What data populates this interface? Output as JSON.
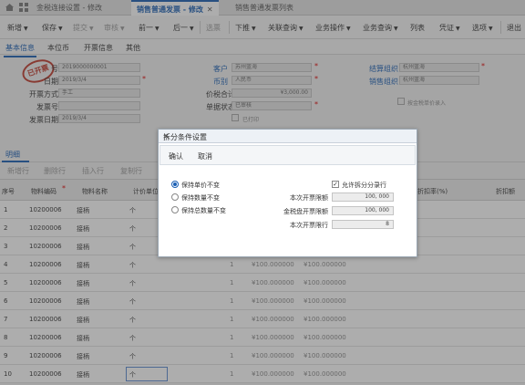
{
  "tabs": [
    {
      "label": "金税连接设置 - 修改",
      "active": false
    },
    {
      "label": "销售普通发票 - 修改",
      "active": true
    },
    {
      "label": "销售普通发票列表",
      "active": false
    }
  ],
  "toolbar": {
    "items": [
      {
        "label": "新增",
        "caret": true,
        "disabled": false
      },
      {
        "label": "保存",
        "caret": true,
        "disabled": false
      },
      {
        "label": "提交",
        "caret": true,
        "disabled": true
      },
      {
        "label": "审核",
        "caret": true,
        "disabled": true
      },
      {
        "label": "前一",
        "caret": true,
        "disabled": false
      },
      {
        "label": "后一",
        "caret": true,
        "disabled": false
      },
      {
        "label": "选票",
        "caret": false,
        "disabled": true
      },
      {
        "label": "下推",
        "caret": true,
        "disabled": false
      },
      {
        "label": "关联查询",
        "caret": true,
        "disabled": false
      },
      {
        "label": "业务操作",
        "caret": true,
        "disabled": false
      },
      {
        "label": "业务查询",
        "caret": true,
        "disabled": false
      },
      {
        "label": "列表",
        "caret": false,
        "disabled": false
      },
      {
        "label": "凭证",
        "caret": true,
        "disabled": false
      },
      {
        "label": "选项",
        "caret": true,
        "disabled": false
      },
      {
        "label": "退出",
        "caret": false,
        "disabled": false
      }
    ]
  },
  "subtabs": [
    "基本信息",
    "本位币",
    "开票信息",
    "其他"
  ],
  "form": {
    "stamp": "已开票",
    "row1": {
      "label": "号",
      "value": "2019000000001"
    },
    "row2": {
      "label": "日期",
      "value": "2019/3/4"
    },
    "row3": {
      "label": "开票方式",
      "value": "手工"
    },
    "row4": {
      "label": "发票号",
      "value": ""
    },
    "row5": {
      "label": "发票日期",
      "value": "2019/3/4"
    },
    "customer": {
      "label": "客户",
      "value": "苏州蓝海"
    },
    "currency": {
      "label": "币别",
      "value": "人民币"
    },
    "tax_total": {
      "label": "价税合计",
      "value": "¥3,000.00"
    },
    "doc_status": {
      "label": "单据状态",
      "value": "已审核"
    },
    "print_check": "已打印",
    "settle_org": {
      "label": "结算组织",
      "value": "杭州蓝海"
    },
    "sales_org": {
      "label": "销售组织",
      "value": "杭州蓝海"
    },
    "tax_check": "按金税单价录入"
  },
  "grid": {
    "section_title": "明细",
    "tools": [
      "新增行",
      "删除行",
      "插入行",
      "复制行"
    ],
    "headers": [
      "序号",
      "物料编码",
      "物料名称",
      "计价单位",
      "折扣率(%)",
      "折扣额"
    ],
    "rows": [
      {
        "seq": "1",
        "code": "10200006",
        "name": "接柄",
        "unit": "个",
        "qty": "",
        "price": "",
        "amount": ""
      },
      {
        "seq": "2",
        "code": "10200006",
        "name": "接柄",
        "unit": "个",
        "qty": "",
        "price": "",
        "amount": ""
      },
      {
        "seq": "3",
        "code": "10200006",
        "name": "接柄",
        "unit": "个",
        "qty": "",
        "price": "",
        "amount": ""
      },
      {
        "seq": "4",
        "code": "10200006",
        "name": "接柄",
        "unit": "个",
        "qty": "1",
        "price": "¥100.000000",
        "amount": "¥100.000000"
      },
      {
        "seq": "5",
        "code": "10200006",
        "name": "接柄",
        "unit": "个",
        "qty": "1",
        "price": "¥100.000000",
        "amount": "¥100.000000"
      },
      {
        "seq": "6",
        "code": "10200006",
        "name": "接柄",
        "unit": "个",
        "qty": "1",
        "price": "¥100.000000",
        "amount": "¥100.000000"
      },
      {
        "seq": "7",
        "code": "10200006",
        "name": "接柄",
        "unit": "个",
        "qty": "1",
        "price": "¥100.000000",
        "amount": "¥100.000000"
      },
      {
        "seq": "8",
        "code": "10200006",
        "name": "接柄",
        "unit": "个",
        "qty": "1",
        "price": "¥100.000000",
        "amount": "¥100.000000"
      },
      {
        "seq": "9",
        "code": "10200006",
        "name": "接柄",
        "unit": "个",
        "qty": "1",
        "price": "¥100.000000",
        "amount": "¥100.000000"
      },
      {
        "seq": "10",
        "code": "10200006",
        "name": "接柄",
        "unit": "个",
        "qty": "1",
        "price": "¥100.000000",
        "amount": "¥100.000000"
      }
    ]
  },
  "dialog": {
    "title": "拆分条件设置",
    "confirm": "确认",
    "cancel": "取消",
    "options": [
      {
        "label": "保持单价不变",
        "selected": true
      },
      {
        "label": "保持数量不变",
        "selected": false
      },
      {
        "label": "保持总数量不变",
        "selected": false
      }
    ],
    "allow_split": {
      "label": "允许拆分分录行",
      "checked": true
    },
    "limit_amount": {
      "label": "本次开票限额",
      "value": "100, 000"
    },
    "tax_limit": {
      "label": "金税盘开票限额",
      "value": "100, 000"
    },
    "row_limit": {
      "label": "本次开票限行",
      "value": "8"
    }
  },
  "colors": {
    "accent": "#1a5fb4",
    "required": "#dd0000",
    "stamp": "#c0392b"
  }
}
